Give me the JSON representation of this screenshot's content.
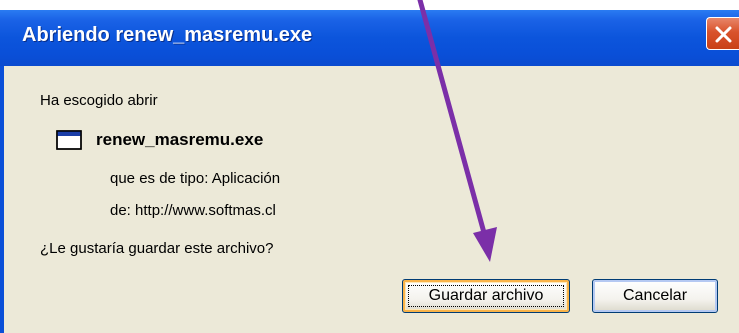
{
  "dialog": {
    "title": "Abriendo renew_masremu.exe",
    "prompt": "Ha escogido abrir",
    "file": {
      "name": "renew_masremu.exe",
      "type_line": "que es de tipo:  Aplicación",
      "from_line": "de:  http://www.softmas.cl",
      "icon": "application-window-icon"
    },
    "question": "¿Le gustaría guardar este archivo?",
    "buttons": {
      "save_label": "Guardar archivo",
      "cancel_label": "Cancelar"
    },
    "close_icon": "close-x-icon"
  },
  "annotation": {
    "color": "#7b2fa8",
    "icon": "purple-arrow-icon"
  },
  "colors": {
    "titlebar": "#0a4fd8",
    "body": "#ece9d8",
    "close_button": "#d9532c"
  }
}
